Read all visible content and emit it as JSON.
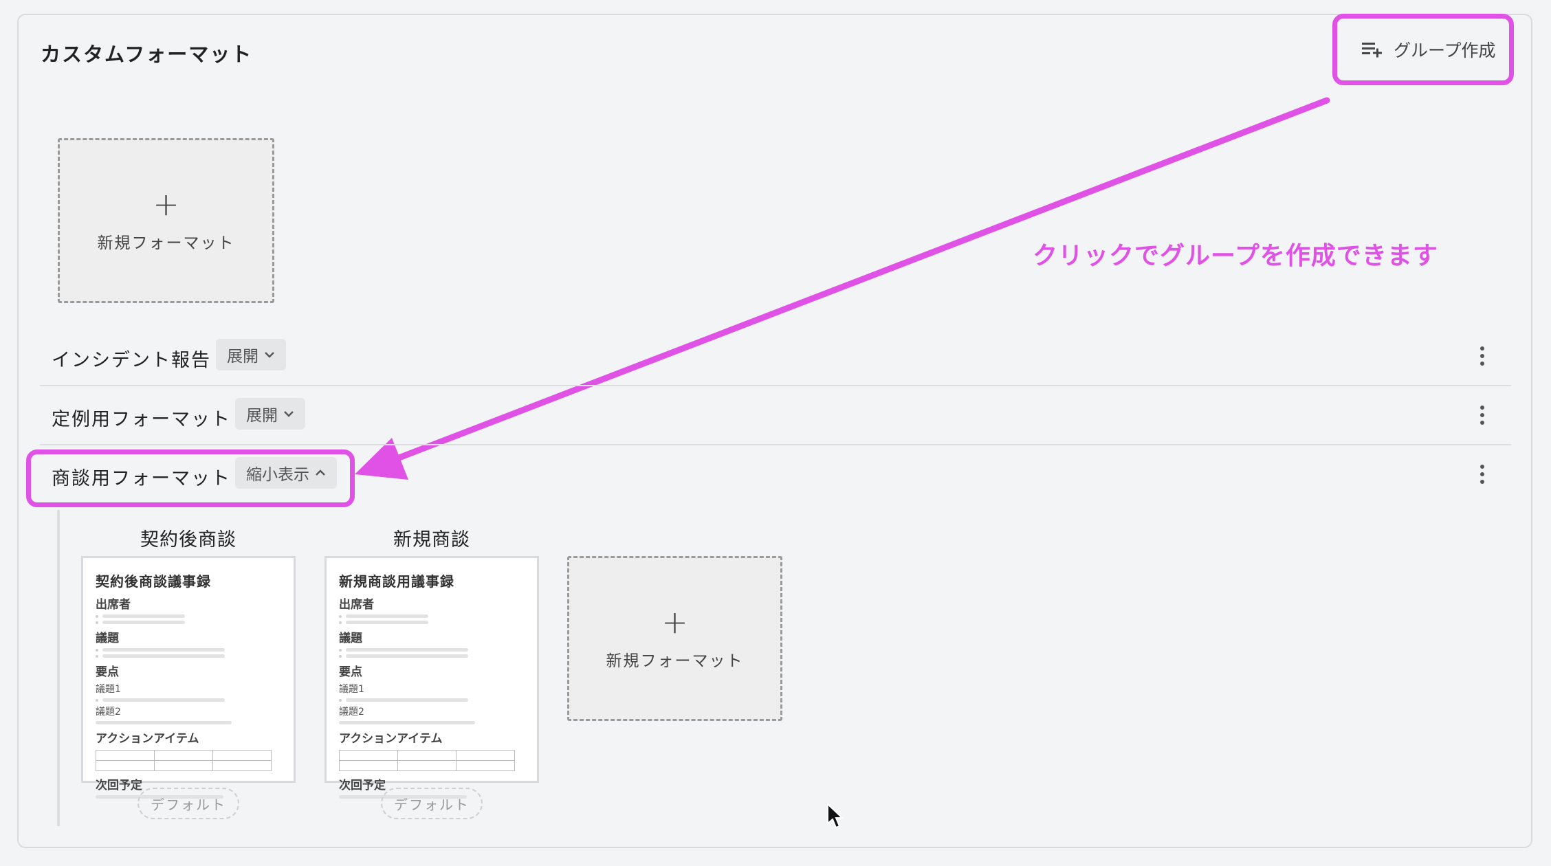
{
  "page": {
    "title": "カスタムフォーマット",
    "group_create_label": "グループ作成",
    "annotation": "クリックでグループを作成できます"
  },
  "top_new_card": {
    "plus": "+",
    "label": "新規フォーマット"
  },
  "groups": [
    {
      "name": "インシデント報告",
      "toggle": "展開",
      "toggle_icon": "chevron-down-icon"
    },
    {
      "name": "定例用フォーマット",
      "toggle": "展開",
      "toggle_icon": "chevron-down-icon"
    },
    {
      "name": "商談用フォーマット",
      "toggle": "縮小表示",
      "toggle_icon": "chevron-up-icon"
    }
  ],
  "formats": [
    {
      "title": "契約後商談",
      "doc": {
        "heading": "契約後商談議事録",
        "attendees": "出席者",
        "agenda": "議題",
        "points": "要点",
        "agenda1": "議題1",
        "agenda2": "議題2",
        "actions": "アクションアイテム",
        "next": "次回予定"
      },
      "badge": "デフォルト"
    },
    {
      "title": "新規商談",
      "doc": {
        "heading": "新規商談用議事録",
        "attendees": "出席者",
        "agenda": "議題",
        "points": "要点",
        "agenda1": "議題1",
        "agenda2": "議題2",
        "actions": "アクションアイテム",
        "next": "次回予定"
      },
      "badge": "デフォルト"
    }
  ],
  "group_new_card": {
    "plus": "+",
    "label": "新規フォーマット"
  },
  "colors": {
    "accent": "#e052e6",
    "background": "#f3f4f6"
  }
}
